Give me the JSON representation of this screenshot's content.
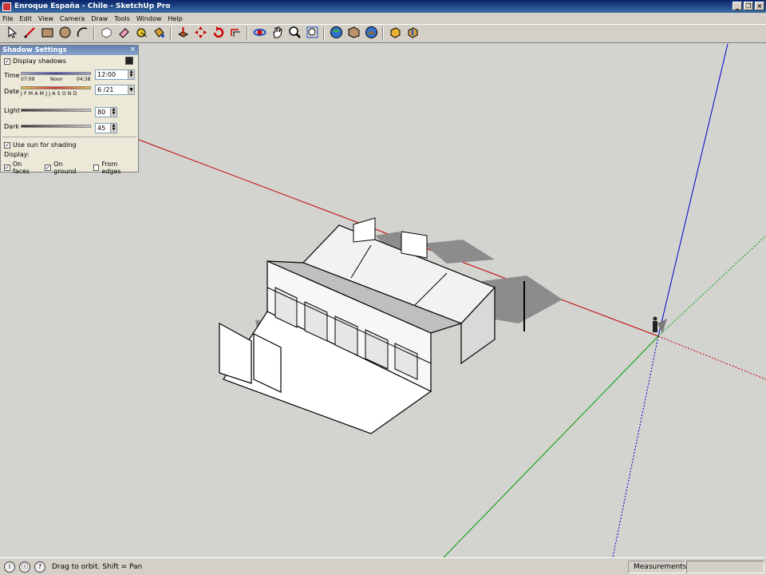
{
  "window": {
    "title": "Enroque España - Chile - SketchUp Pro"
  },
  "menu": [
    "File",
    "Edit",
    "View",
    "Camera",
    "Draw",
    "Tools",
    "Window",
    "Help"
  ],
  "toolbar": [
    {
      "icon": "select-arrow-icon"
    },
    {
      "icon": "pencil-line-icon"
    },
    {
      "icon": "rectangle-icon"
    },
    {
      "icon": "circle-icon"
    },
    {
      "icon": "arc-icon"
    },
    {
      "sep": true
    },
    {
      "icon": "make-component-icon"
    },
    {
      "icon": "eraser-icon"
    },
    {
      "icon": "tape-measure-icon"
    },
    {
      "icon": "paint-bucket-icon"
    },
    {
      "sep": true
    },
    {
      "icon": "push-pull-icon"
    },
    {
      "icon": "move-icon"
    },
    {
      "icon": "rotate-icon"
    },
    {
      "icon": "offset-icon"
    },
    {
      "sep": true
    },
    {
      "icon": "orbit-icon"
    },
    {
      "icon": "pan-icon"
    },
    {
      "icon": "zoom-icon"
    },
    {
      "icon": "zoom-extents-icon"
    },
    {
      "sep": true
    },
    {
      "icon": "google-earth-icon"
    },
    {
      "icon": "add-location-icon"
    },
    {
      "icon": "toggle-terrain-icon"
    },
    {
      "sep": true
    },
    {
      "icon": "get-models-icon"
    },
    {
      "icon": "share-model-icon"
    }
  ],
  "shadow_settings": {
    "title": "Shadow Settings",
    "display_shadows_label": "Display shadows",
    "display_shadows": true,
    "time_label": "Time",
    "time_start": "07:09",
    "time_noon": "Noon",
    "time_end": "04:38",
    "time_value": "12:00",
    "date_label": "Date",
    "months": "J F M A M J J A S O N D",
    "date_value": "6 /21",
    "light_label": "Light",
    "light_value": "80",
    "dark_label": "Dark",
    "dark_value": "45",
    "use_sun_label": "Use sun for shading",
    "use_sun": true,
    "display_label": "Display:",
    "on_faces_label": "On faces",
    "on_faces": true,
    "on_ground_label": "On ground",
    "on_ground": true,
    "from_edges_label": "From edges",
    "from_edges": false
  },
  "statusbar": {
    "hint": "Drag to orbit.  Shift = Pan",
    "measurements_label": "Measurements",
    "measurements_value": ""
  },
  "colors": {
    "viewport_bg": "#d3d3d0",
    "red_axis": "#c00000",
    "green_axis": "#00a000",
    "blue_axis": "#0000cc",
    "shadow": "#8c8c8c",
    "face": "#ffffff"
  }
}
